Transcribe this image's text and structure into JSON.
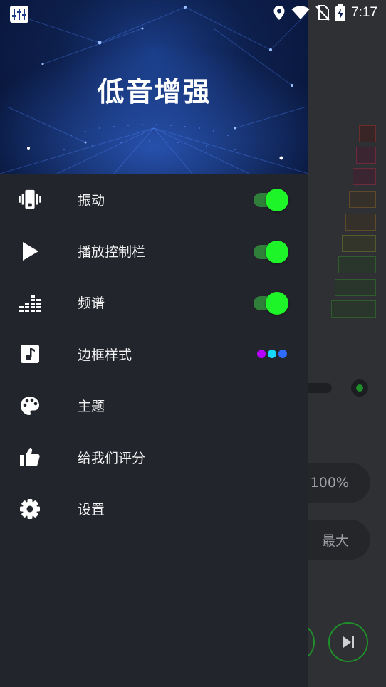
{
  "status_bar": {
    "time": "7:17",
    "icons": [
      "equalizer-icon",
      "location-icon",
      "wifi-icon",
      "no-sim-icon",
      "battery-charging-icon"
    ]
  },
  "drawer": {
    "title": "低音增强",
    "menu": [
      {
        "label": "振动",
        "icon": "vibration-icon",
        "control": "toggle",
        "on": true
      },
      {
        "label": "播放控制栏",
        "icon": "play-icon",
        "control": "toggle",
        "on": true
      },
      {
        "label": "频谱",
        "icon": "spectrum-icon",
        "control": "toggle",
        "on": true
      },
      {
        "label": "边框样式",
        "icon": "music-note-icon",
        "control": "color-dots",
        "colors": [
          "#b400ff",
          "#18d8ff",
          "#2f6dff"
        ]
      },
      {
        "label": "主题",
        "icon": "palette-icon"
      },
      {
        "label": "给我们评分",
        "icon": "thumbs-up-icon"
      },
      {
        "label": "设置",
        "icon": "gear-icon"
      }
    ]
  },
  "background": {
    "volume_percent": "100%",
    "max_label": "最大"
  },
  "colors": {
    "toggle_on": "#1ef528",
    "drawer_bg": "#23252c"
  }
}
